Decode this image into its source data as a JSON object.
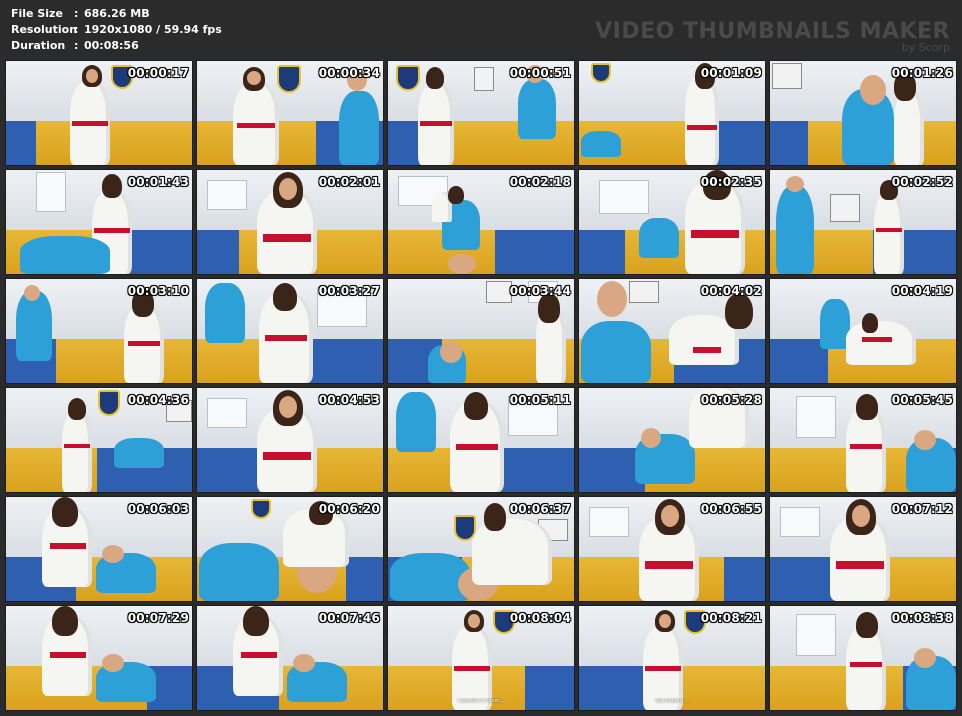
{
  "header": {
    "file_size_label": "File Size",
    "file_size_value": "686.26 MB",
    "resolution_label": "Resolution",
    "resolution_value": "1920x1080 / 59.94 fps",
    "duration_label": "Duration",
    "duration_value": "00:08:56",
    "separator": ":"
  },
  "brand": {
    "title": "VIDEO THUMBNAILS MAKER",
    "subtitle": "by Scorp"
  },
  "thumbnails": [
    {
      "timestamp": "00:00:17",
      "scene": "girl-logo"
    },
    {
      "timestamp": "00:00:34",
      "scene": "girl-man"
    },
    {
      "timestamp": "00:00:51",
      "scene": "girl-man-center"
    },
    {
      "timestamp": "00:01:09",
      "scene": "man-bend"
    },
    {
      "timestamp": "00:01:26",
      "scene": "man-close"
    },
    {
      "timestamp": "00:01:43",
      "scene": "girl-man-floor"
    },
    {
      "timestamp": "00:02:01",
      "scene": "girl-close"
    },
    {
      "timestamp": "00:02:18",
      "scene": "throw"
    },
    {
      "timestamp": "00:02:35",
      "scene": "girl-hall"
    },
    {
      "timestamp": "00:02:52",
      "scene": "man-girl-hall"
    },
    {
      "timestamp": "00:03:10",
      "scene": "man-girl-wall"
    },
    {
      "timestamp": "00:03:27",
      "scene": "girl-throw"
    },
    {
      "timestamp": "00:03:44",
      "scene": "man-floor"
    },
    {
      "timestamp": "00:04:02",
      "scene": "kick"
    },
    {
      "timestamp": "00:04:19",
      "scene": "split"
    },
    {
      "timestamp": "00:04:36",
      "scene": "girl-man-logo"
    },
    {
      "timestamp": "00:04:53",
      "scene": "girl-close"
    },
    {
      "timestamp": "00:05:11",
      "scene": "girl-throw"
    },
    {
      "timestamp": "00:05:28",
      "scene": "man-floor-top"
    },
    {
      "timestamp": "00:05:45",
      "scene": "girl-man-hall"
    },
    {
      "timestamp": "00:06:03",
      "scene": "ground-hold"
    },
    {
      "timestamp": "00:06:20",
      "scene": "ground-head"
    },
    {
      "timestamp": "00:06:37",
      "scene": "ground-sit"
    },
    {
      "timestamp": "00:06:55",
      "scene": "girl-close"
    },
    {
      "timestamp": "00:07:12",
      "scene": "girl-close"
    },
    {
      "timestamp": "00:07:29",
      "scene": "ground-hold"
    },
    {
      "timestamp": "00:07:46",
      "scene": "ground-hold"
    },
    {
      "timestamp": "00:08:04",
      "scene": "girl-choke",
      "caption": "I would it's them..."
    },
    {
      "timestamp": "00:08:21",
      "scene": "girl-choke",
      "caption": "You know it..."
    },
    {
      "timestamp": "00:08:38",
      "scene": "girl-man-hall"
    }
  ],
  "colors": {
    "background": "#2b2b2b",
    "text": "#ffffff",
    "brand": "#4a4a4a",
    "mat_yellow": "#e2ae2b",
    "mat_blue": "#2f5fb0",
    "gi_white": "#f5f5f2",
    "belt_red": "#c8102e",
    "shirt_blue": "#2ea0d8"
  }
}
